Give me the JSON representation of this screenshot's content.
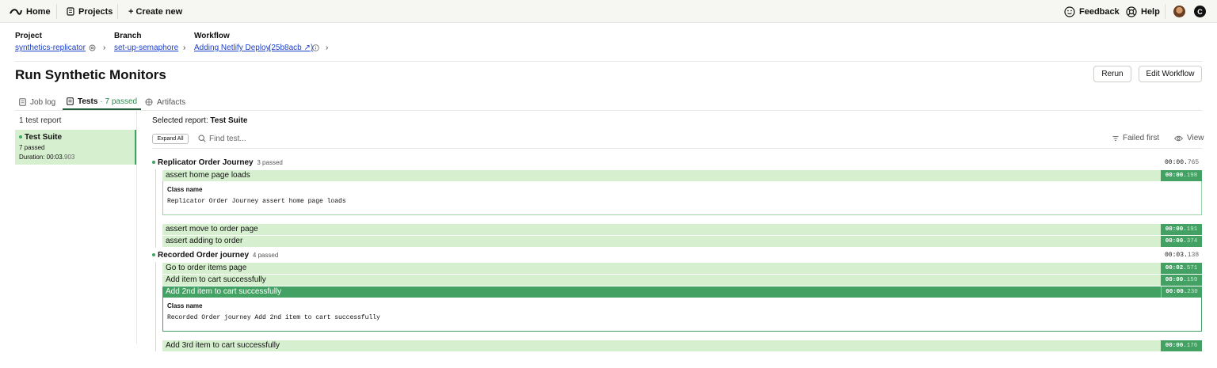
{
  "topbar": {
    "home": "Home",
    "projects": "Projects",
    "create_new": "+ Create new",
    "feedback": "Feedback",
    "help": "Help",
    "user_initial": "C"
  },
  "header": {
    "project_label": "Project",
    "project_value": "synthetics-replicator",
    "branch_label": "Branch",
    "branch_value": "set-up-semaphore",
    "workflow_label": "Workflow",
    "workflow_value": "Adding Netlify Deploy",
    "commit": "(25b8acb ↗)",
    "crumb_sep": "›"
  },
  "page": {
    "title": "Run Synthetic Monitors",
    "rerun": "Rerun",
    "edit_workflow": "Edit Workflow"
  },
  "tabs": {
    "job_log": "Job log",
    "tests": "Tests",
    "tests_count": "· 7 passed",
    "artifacts": "Artifacts"
  },
  "left": {
    "report_count": "1 test report",
    "suite_name": "Test Suite",
    "suite_passed": "7 passed",
    "suite_duration_label": "Duration: 00:03.",
    "suite_duration_ms": "903"
  },
  "right": {
    "selected_label": "Selected report:",
    "selected_value": "Test Suite",
    "expand_all": "Expand All",
    "find_placeholder": "Find test...",
    "failed_first": "Failed first",
    "view": "View",
    "class_name_label": "Class name"
  },
  "groups": [
    {
      "name": "Replicator Order Journey",
      "passed": "3 passed",
      "time": "00:00.",
      "time_ms": "765",
      "tests": [
        {
          "name": "assert home page loads",
          "time": "00:00.",
          "ms": "198",
          "class_name": "Replicator Order Journey assert home page loads"
        },
        {
          "name": "assert move to order page",
          "time": "00:00.",
          "ms": "191"
        },
        {
          "name": "assert adding to order",
          "time": "00:00.",
          "ms": "374"
        }
      ]
    },
    {
      "name": "Recorded Order journey",
      "passed": "4 passed",
      "time": "00:03.",
      "time_ms": "138",
      "tests": [
        {
          "name": "Go to order items page",
          "time": "00:02.",
          "ms": "571"
        },
        {
          "name": "Add item to cart successfully",
          "time": "00:00.",
          "ms": "159"
        },
        {
          "name": "Add 2nd item to cart successfully",
          "time": "00:00.",
          "ms": "230",
          "class_name": "Recorded Order journey Add 2nd item to cart successfully"
        },
        {
          "name": "Add 3rd item to cart successfully",
          "time": "00:00.",
          "ms": "176"
        }
      ]
    }
  ],
  "colors": {
    "pass_green": "#43a163",
    "pass_light": "#d6f0cf",
    "link_blue": "#1a3fc9"
  }
}
